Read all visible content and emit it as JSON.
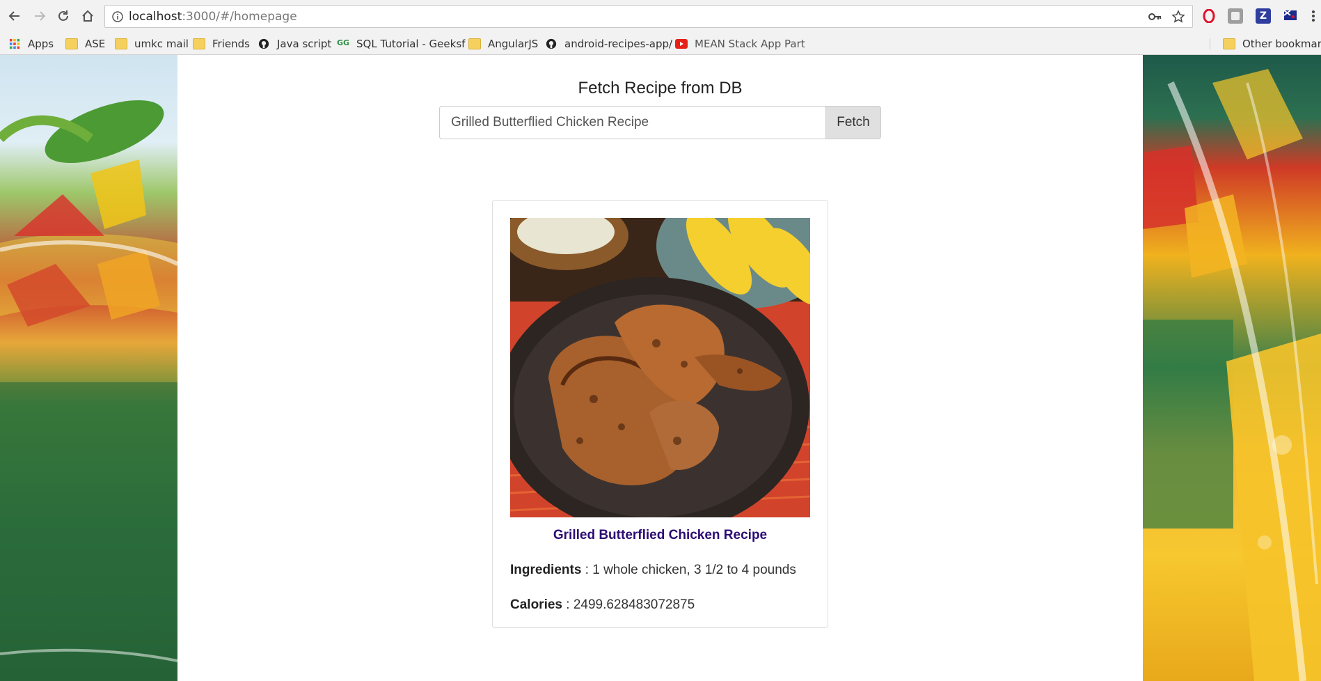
{
  "browser": {
    "url_host": "localhost",
    "url_path": ":3000/#/homepage"
  },
  "bookmarks": [
    {
      "label": "Apps",
      "icon": "apps-grid-icon"
    },
    {
      "label": "ASE",
      "icon": "folder-icon"
    },
    {
      "label": "umkc mail",
      "icon": "folder-icon"
    },
    {
      "label": "Friends",
      "icon": "folder-icon"
    },
    {
      "label": "Java script",
      "icon": "github-icon"
    },
    {
      "label": "SQL Tutorial - Geeksf",
      "icon": "geeksforgeeks-icon"
    },
    {
      "label": "AngularJS",
      "icon": "folder-icon"
    },
    {
      "label": "android-recipes-app/",
      "icon": "github-icon"
    },
    {
      "label": "MEAN Stack App Part",
      "icon": "youtube-icon"
    },
    {
      "label": "Other bookmarks",
      "icon": "folder-icon"
    }
  ],
  "page": {
    "title": "Fetch Recipe from DB",
    "search_value": "Grilled Butterflied Chicken Recipe",
    "fetch_label": "Fetch"
  },
  "recipe": {
    "name": "Grilled Butterflied Chicken Recipe",
    "ingredients_label": "Ingredients",
    "ingredients_value": " : 1 whole chicken, 3 1/2 to 4 pounds",
    "calories_label": "Calories",
    "calories_value": " : 2499.628483072875"
  },
  "colors": {
    "recipe_link": "#2b0b73",
    "fetch_button_bg": "#e0e0e0"
  }
}
